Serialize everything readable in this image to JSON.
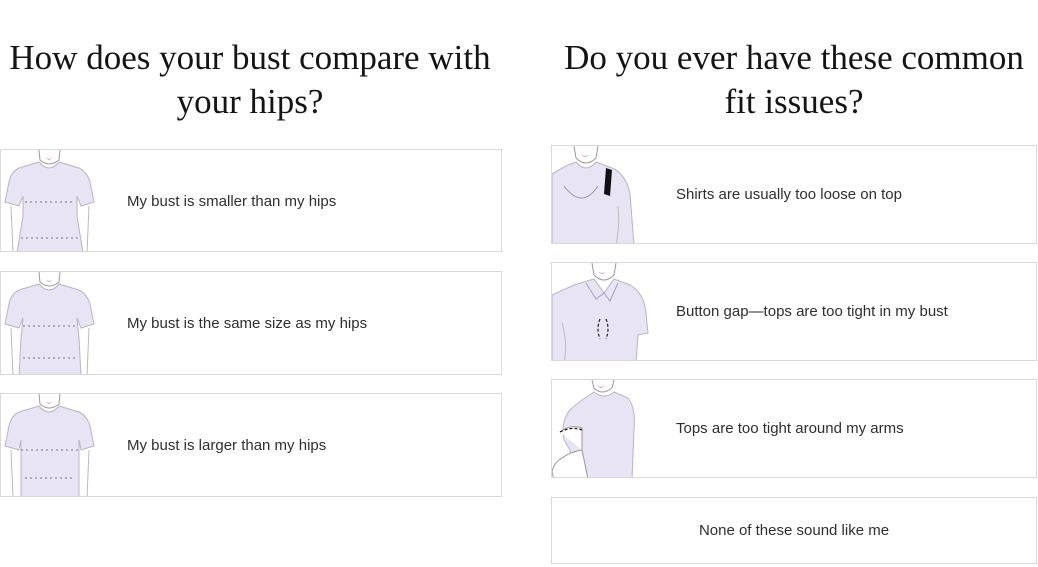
{
  "bust_question": {
    "title": "How does your bust compare with your hips?",
    "options": [
      {
        "label": "My bust is smaller than my hips",
        "icon": "figure-bust-smaller-icon"
      },
      {
        "label": "My bust is the same size as my hips",
        "icon": "figure-bust-same-icon"
      },
      {
        "label": "My bust is larger than my hips",
        "icon": "figure-bust-larger-icon"
      }
    ]
  },
  "fit_question": {
    "title": "Do you ever have these common fit issues?",
    "options": [
      {
        "label": "Shirts are usually too loose on top",
        "icon": "loose-shoulder-icon"
      },
      {
        "label": "Button gap—tops are too tight in my bust",
        "icon": "button-gap-icon"
      },
      {
        "label": "Tops are too tight around my arms",
        "icon": "tight-arm-icon"
      },
      {
        "label": "None of these sound like me"
      }
    ]
  },
  "colors": {
    "garment": "#e8e4f4",
    "lips": "#b5177f",
    "outline": "#9a9a9a",
    "border": "#d9d9d9"
  }
}
